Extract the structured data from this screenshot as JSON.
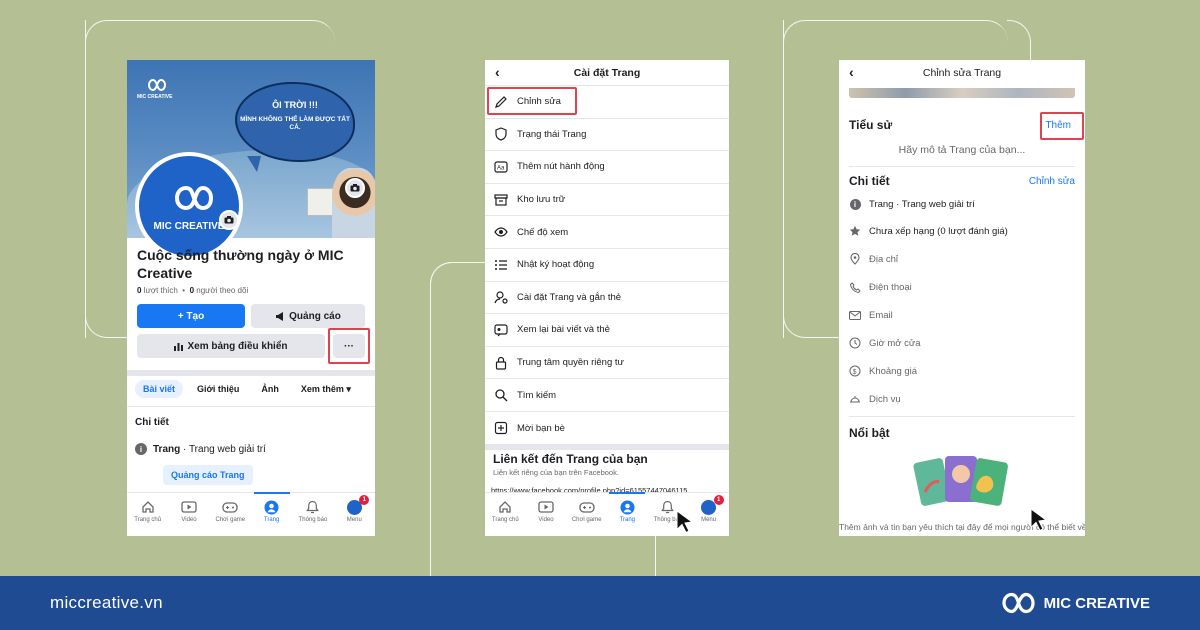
{
  "phone1": {
    "cover_logo_text": "MIC CREATIVE",
    "bubble_line1": "ÔI TRỜI !!!",
    "bubble_line2": "MÌNH KHÔNG THỂ LÀM ĐƯỢC TẤT CẢ.",
    "avatar_text": "MIC CREATIVE",
    "page_name": "Cuộc sống thường ngày ở MIC Creative",
    "likes_count": "0",
    "likes_label": "lượt thích",
    "followers_count": "0",
    "followers_label": "người theo dõi",
    "create_button": "+ Tạo",
    "ads_button": "Quảng cáo",
    "dashboard_button": "Xem bảng điều khiển",
    "more_button": "···",
    "tabs": [
      "Bài viết",
      "Giới thiệu",
      "Ảnh",
      "Xem thêm ▾"
    ],
    "details_title": "Chi tiết",
    "category_bold": "Trang",
    "category_rest": "· Trang web giải trí",
    "ad_page_button": "Quảng cáo Trang",
    "nav": [
      {
        "label": "Trang chủ",
        "icon": "home-icon"
      },
      {
        "label": "Video",
        "icon": "video-icon"
      },
      {
        "label": "Chơi game",
        "icon": "gaming-icon"
      },
      {
        "label": "Trang",
        "icon": "page-icon"
      },
      {
        "label": "Thông báo",
        "icon": "bell-icon"
      },
      {
        "label": "Menu",
        "icon": "menu-avatar-icon",
        "badge": "1"
      }
    ]
  },
  "phone2": {
    "header_title": "Cài đặt Trang",
    "items": [
      {
        "label": "Chỉnh sửa",
        "icon": "pencil-icon"
      },
      {
        "label": "Trạng thái Trang",
        "icon": "shield-icon"
      },
      {
        "label": "Thêm nút hành động",
        "icon": "action-button-icon"
      },
      {
        "label": "Kho lưu trữ",
        "icon": "archive-icon"
      },
      {
        "label": "Chế độ xem",
        "icon": "eye-icon"
      },
      {
        "label": "Nhật ký hoạt động",
        "icon": "list-icon"
      },
      {
        "label": "Cài đặt Trang và gắn thẻ",
        "icon": "tag-settings-icon"
      },
      {
        "label": "Xem lại bài viết và thẻ",
        "icon": "review-icon"
      },
      {
        "label": "Trung tâm quyền riêng tư",
        "icon": "lock-icon"
      },
      {
        "label": "Tìm kiếm",
        "icon": "search-icon"
      },
      {
        "label": "Mời bạn bè",
        "icon": "invite-icon"
      }
    ],
    "link_title": "Liên kết đến Trang của bạn",
    "link_subtitle": "Liên kết riêng của bạn trên Facebook.",
    "link_url": "https://www.facebook.com/profile.php?id=61557447046115",
    "nav": [
      {
        "label": "Trang chủ"
      },
      {
        "label": "Video"
      },
      {
        "label": "Chơi game"
      },
      {
        "label": "Trang"
      },
      {
        "label": "Thông báo"
      },
      {
        "label": "Menu",
        "badge": "1"
      }
    ]
  },
  "phone3": {
    "header_title": "Chỉnh sửa Trang",
    "bio_title": "Tiểu sử",
    "bio_add": "Thêm",
    "bio_placeholder": "Hãy mô tả Trang của bạn...",
    "details_title": "Chi tiết",
    "details_edit": "Chỉnh sửa",
    "rows": [
      {
        "label": "Trang · Trang web giải trí",
        "icon": "info-icon",
        "muted": false
      },
      {
        "label": "Chưa xếp hạng (0 lượt đánh giá)",
        "icon": "star-icon",
        "muted": false
      },
      {
        "label": "Địa chỉ",
        "icon": "location-icon",
        "muted": true
      },
      {
        "label": "Điện thoại",
        "icon": "phone-icon",
        "muted": true
      },
      {
        "label": "Email",
        "icon": "mail-icon",
        "muted": true
      },
      {
        "label": "Giờ mở cửa",
        "icon": "clock-icon",
        "muted": true
      },
      {
        "label": "Khoảng giá",
        "icon": "dollar-icon",
        "muted": true
      },
      {
        "label": "Dịch vụ",
        "icon": "service-bell-icon",
        "muted": true
      }
    ],
    "featured_title": "Nổi bật",
    "featured_caption": "Thêm ảnh và tin bạn yêu thích tại đây để mọi người có thể biết về bạn."
  },
  "footer": {
    "url": "miccreative.vn",
    "brand": "MIC CREATIVE"
  },
  "colors": {
    "background": "#b4bf94",
    "footer": "#1f4b93",
    "facebook_blue": "#1877f2",
    "highlight_red": "#e0434f"
  }
}
